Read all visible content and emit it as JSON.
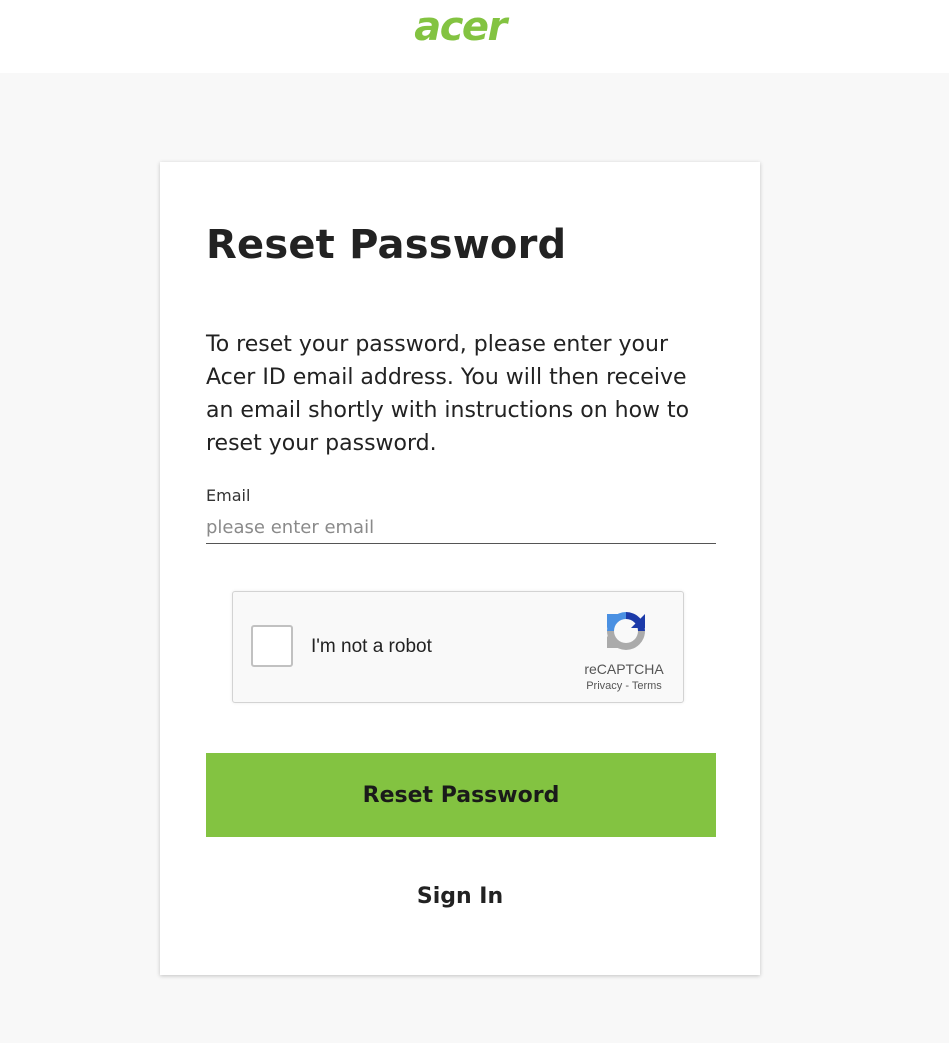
{
  "header": {
    "logo_text": "acer",
    "logo_color": "#83c341"
  },
  "form": {
    "title": "Reset Password",
    "description": "To reset your password, please enter your Acer ID email address. You will then receive an email shortly with instructions on how to reset your password.",
    "email_label": "Email",
    "email_placeholder": "please enter email",
    "email_value": ""
  },
  "recaptcha": {
    "checkbox_label": "I'm not a robot",
    "brand": "reCAPTCHA",
    "privacy_link": "Privacy",
    "separator": "-",
    "terms_link": "Terms",
    "checked": false,
    "icon": "recaptcha-logo-icon"
  },
  "actions": {
    "reset_button_label": "Reset Password",
    "reset_button_color": "#83c341",
    "sign_in_label": "Sign In"
  }
}
